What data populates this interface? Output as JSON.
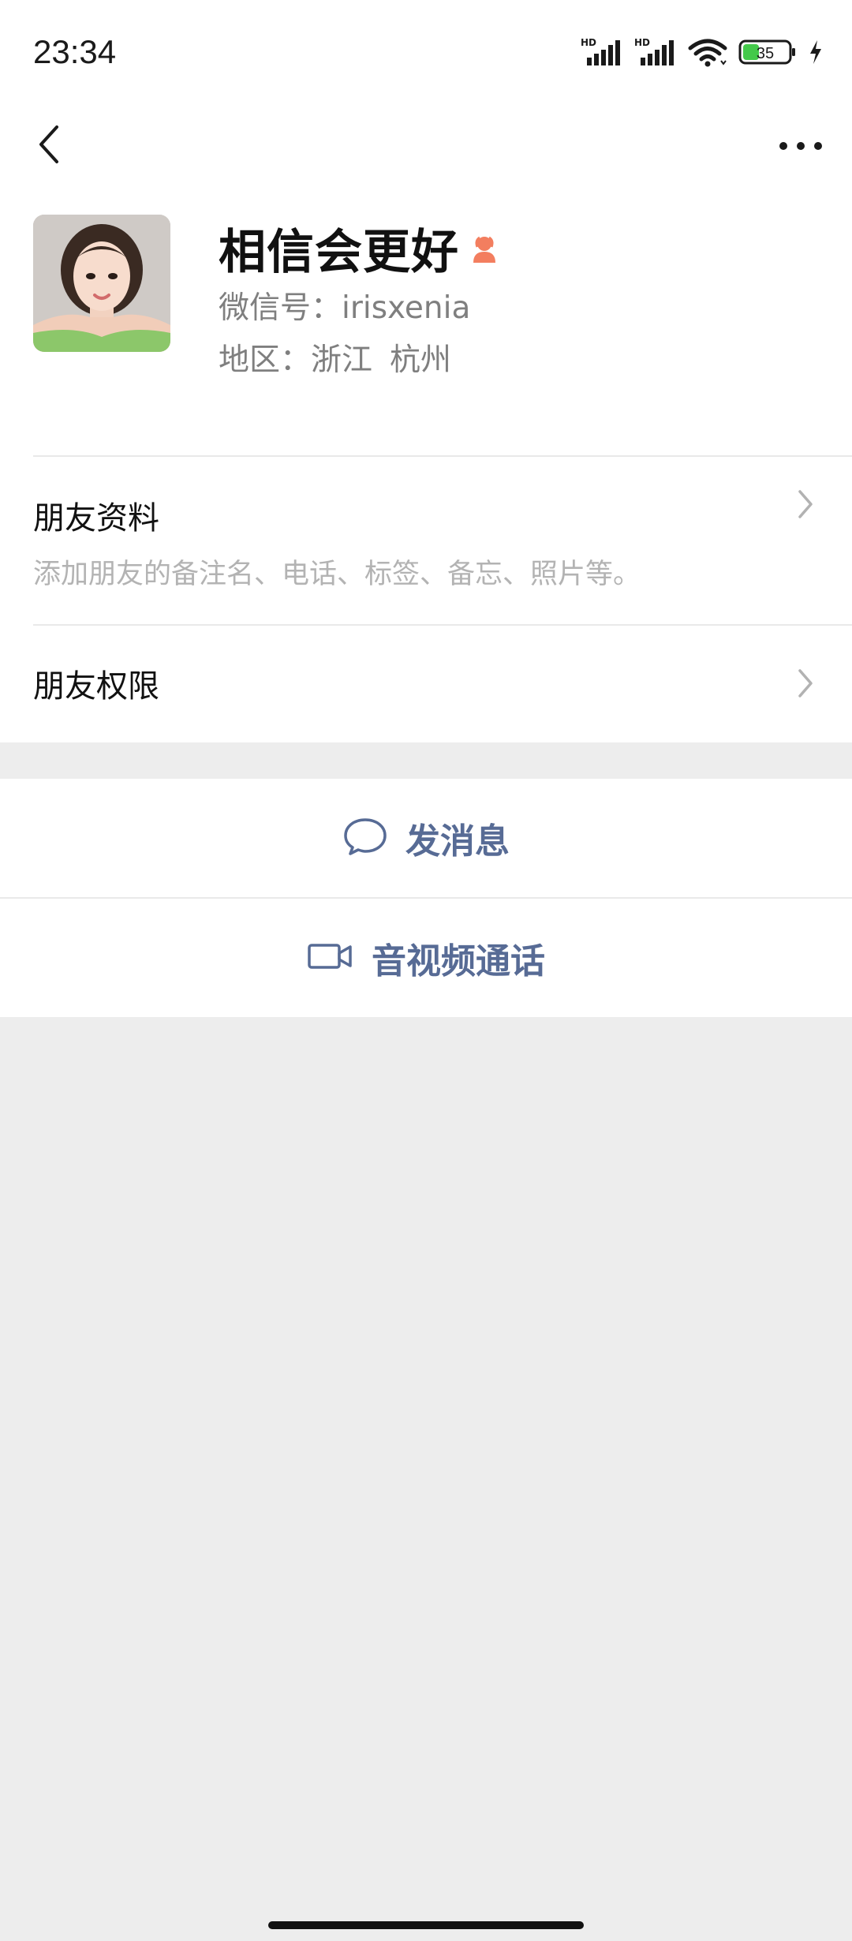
{
  "status_bar": {
    "time": "23:34",
    "signal1_label": "HD",
    "signal2_label": "HD",
    "battery_level": "35",
    "icons": [
      "signal-icon",
      "signal-icon",
      "wifi-icon",
      "battery-icon",
      "charging-icon"
    ]
  },
  "header": {
    "back_icon": "chevron-left-icon",
    "more_icon": "more-dots-icon"
  },
  "profile": {
    "nickname": "相信会更好",
    "gender_icon": "female-icon",
    "gender_color": "#f37e5f",
    "wechat_id": "微信号：irisxenia",
    "region_label": "地区：",
    "region_province": "浙江",
    "region_city": "杭州"
  },
  "cells": {
    "friend_info": {
      "title": "朋友资料",
      "subtitle": "添加朋友的备注名、电话、标签、备忘、照片等。"
    },
    "friend_permissions": {
      "title": "朋友权限"
    }
  },
  "actions": {
    "message": {
      "label": "发消息",
      "icon": "chat-bubble-icon"
    },
    "call": {
      "label": "音视频通话",
      "icon": "video-camera-icon"
    },
    "accent_color": "#576b95"
  }
}
